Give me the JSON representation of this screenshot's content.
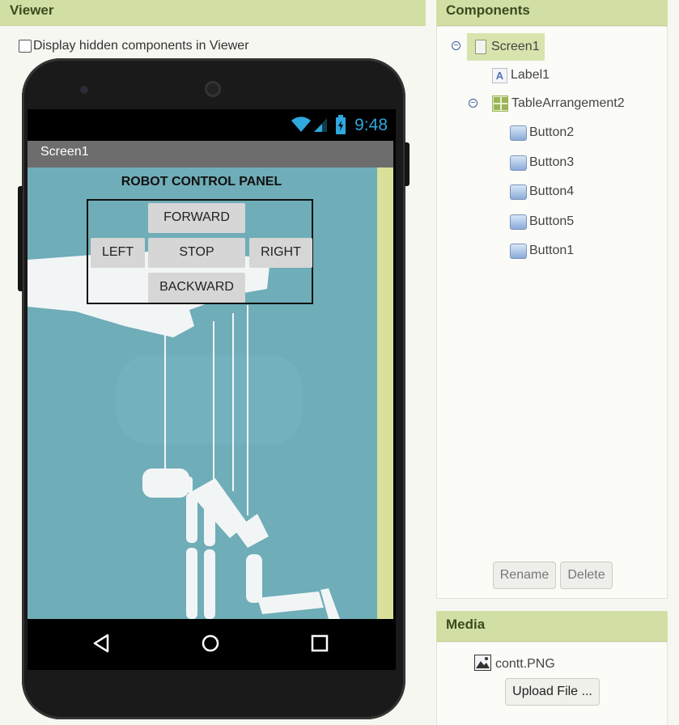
{
  "viewer": {
    "header": "Viewer",
    "hidden_checkbox_label": "Display hidden components in Viewer",
    "phone": {
      "clock": "9:48",
      "screen_title": "Screen1",
      "app_title": "ROBOT CONTROL PANEL",
      "buttons": {
        "forward": "FORWARD",
        "left": "LEFT",
        "stop": "STOP",
        "right": "RIGHT",
        "backward": "BACKWARD"
      }
    }
  },
  "components": {
    "header": "Components",
    "tree": {
      "screen": "Screen1",
      "label": "Label1",
      "table": "TableArrangement2",
      "buttons": [
        "Button2",
        "Button3",
        "Button4",
        "Button5",
        "Button1"
      ]
    },
    "rename_label": "Rename",
    "delete_label": "Delete"
  },
  "media": {
    "header": "Media",
    "file": "contt.PNG",
    "upload_label": "Upload File ..."
  },
  "colors": {
    "header_green": "#d1dfa5",
    "app_background": "#6fadb8",
    "selected_highlight": "#d8e4ad",
    "status_blue": "#2fa8de"
  }
}
